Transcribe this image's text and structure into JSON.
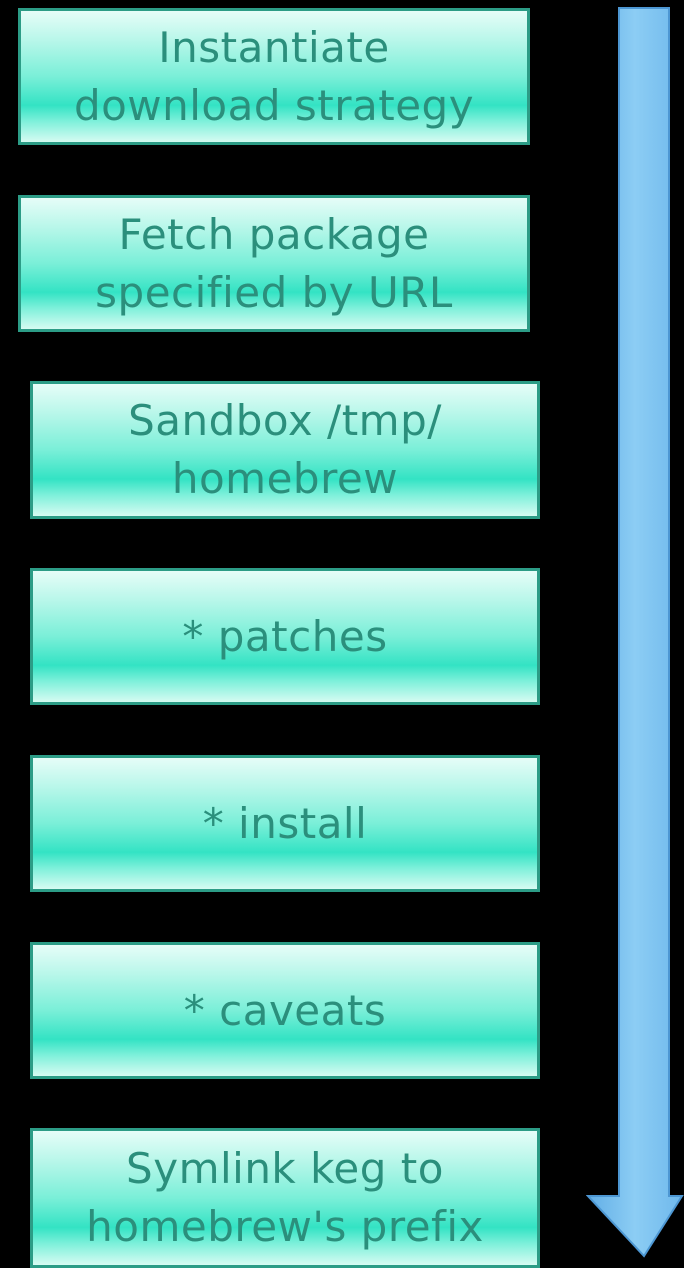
{
  "steps": [
    {
      "line1": "Instantiate",
      "line2": "download strategy"
    },
    {
      "line1": "Fetch package",
      "line2": "specified by URL"
    },
    {
      "line1": "Sandbox /tmp/",
      "line2": "homebrew"
    },
    {
      "line1": "* patches"
    },
    {
      "line1": "* install"
    },
    {
      "line1": "* caveats"
    },
    {
      "line1": "Symlink keg to",
      "line2": "homebrew's prefix"
    }
  ],
  "colors": {
    "background": "#000000",
    "box_fill": "#33e3c4",
    "box_border": "#2c9c86",
    "box_text": "#2b8f7c",
    "arrow_fill": "#80c4f0",
    "arrow_edge": "#4d97d3"
  },
  "arrow": {
    "direction": "down",
    "icon": "down-arrow-icon"
  }
}
